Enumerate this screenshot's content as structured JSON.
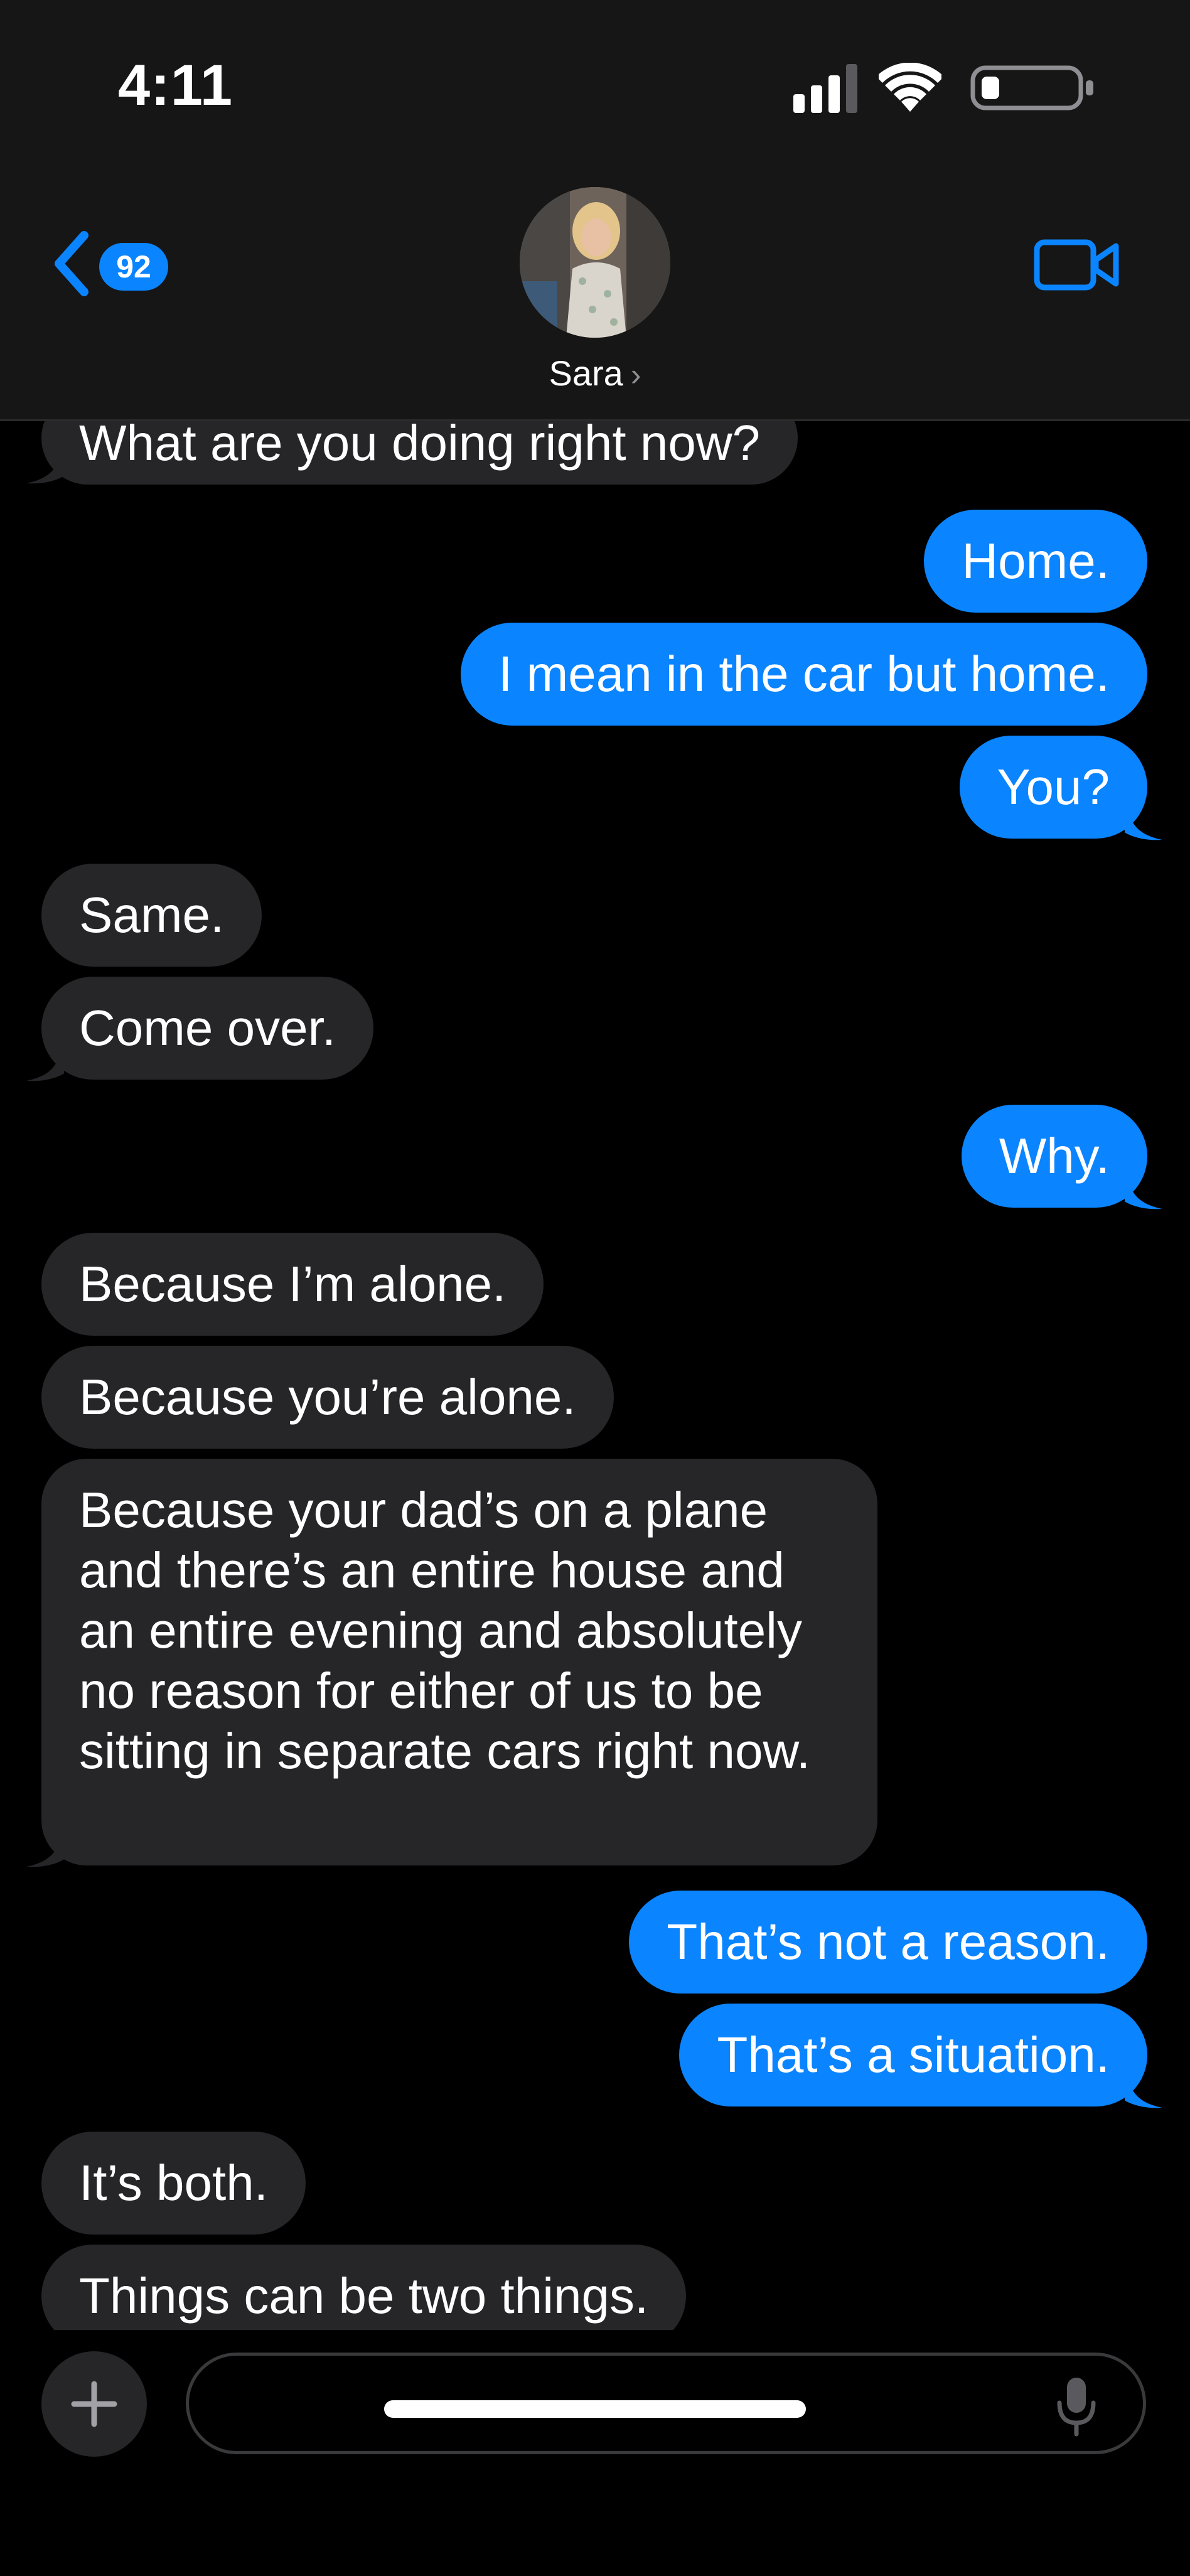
{
  "status_bar": {
    "time": "4:11"
  },
  "header": {
    "unread_count": "92",
    "contact_name": "Sara",
    "contact_chevron": "›"
  },
  "messages": [
    {
      "side": "in",
      "text": "What are you doing right now?"
    },
    {
      "side": "out",
      "text": "Home."
    },
    {
      "side": "out",
      "text": "I mean in the car but home."
    },
    {
      "side": "out",
      "text": "You?"
    },
    {
      "side": "in",
      "text": "Same."
    },
    {
      "side": "in",
      "text": "Come over."
    },
    {
      "side": "out",
      "text": "Why."
    },
    {
      "side": "in",
      "text": "Because I’m alone."
    },
    {
      "side": "in",
      "text": "Because you’re alone."
    },
    {
      "side": "in",
      "text": "Because your dad’s on a plane and there’s an entire house and an entire evening and absolutely no reason for either of us to be sitting in separate cars right now."
    },
    {
      "side": "out",
      "text": "That’s not a reason."
    },
    {
      "side": "out",
      "text": "That’s a situation."
    },
    {
      "side": "in",
      "text": "It’s both."
    },
    {
      "side": "in",
      "text": "Things can be two things."
    }
  ],
  "composer": {
    "placeholder": ""
  },
  "colors": {
    "accent": "#0a84ff",
    "incoming_bubble": "#262629",
    "background": "#000000",
    "header": "#161616"
  },
  "icons": [
    "back-chevron-icon",
    "video-camera-icon",
    "signal-icon",
    "wifi-icon",
    "battery-icon",
    "plus-icon",
    "microphone-icon"
  ]
}
